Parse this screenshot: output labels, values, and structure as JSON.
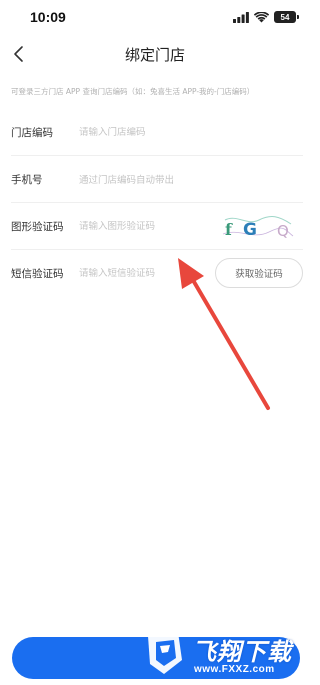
{
  "status_bar": {
    "time": "10:09",
    "battery": "54"
  },
  "nav": {
    "title": "绑定门店"
  },
  "notice": "可登录三方门店 APP 查询门店编码（如：兔喜生活 APP-我的-门店编码）",
  "form": {
    "store_code": {
      "label": "门店编码",
      "placeholder": "请输入门店编码"
    },
    "phone": {
      "label": "手机号",
      "value": "通过门店编码自动带出"
    },
    "captcha": {
      "label": "图形验证码",
      "placeholder": "请输入图形验证码",
      "image_text": "fGQ"
    },
    "sms": {
      "label": "短信验证码",
      "placeholder": "请输入短信验证码",
      "button": "获取验证码"
    }
  },
  "watermark": {
    "title": "飞翔下载",
    "url": "www.FXXZ.com"
  },
  "colors": {
    "primary": "#1a6ef0",
    "annotation_arrow": "#e8473c"
  }
}
